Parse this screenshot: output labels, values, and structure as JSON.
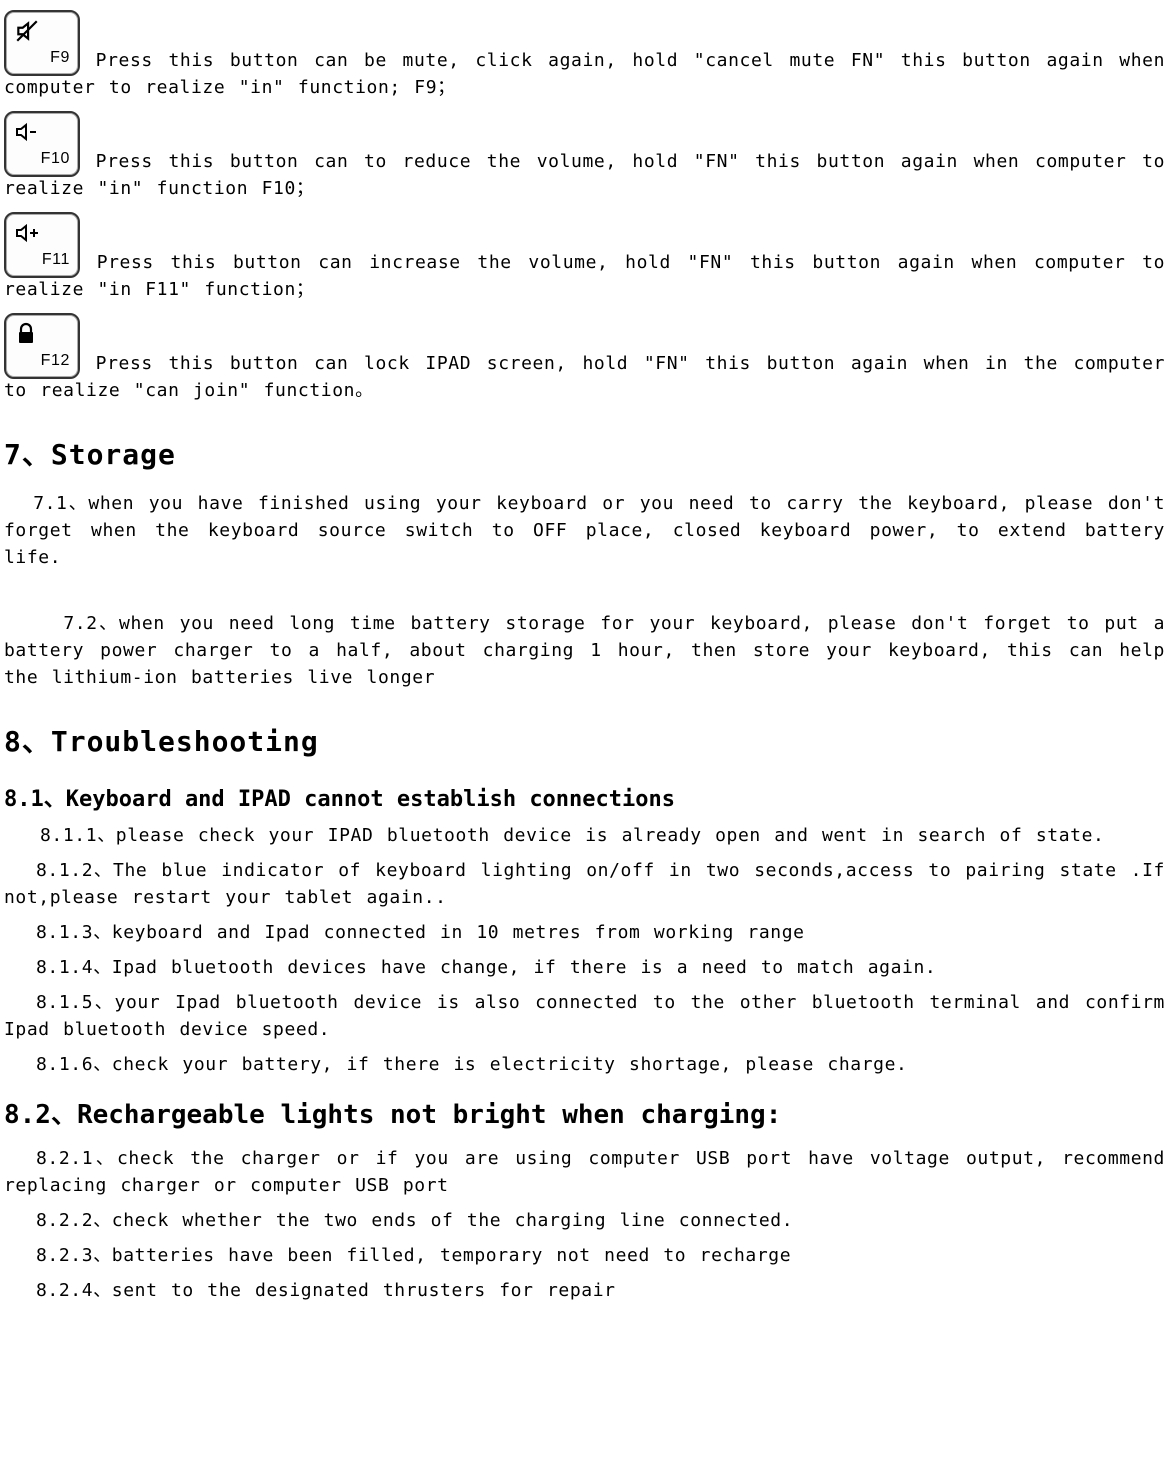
{
  "keys": {
    "f9": {
      "label": "F9",
      "text": " Press this button can be mute, click again, hold \"cancel mute FN\" this button again when computer to realize \"in\" function; F9；"
    },
    "f10": {
      "label": "F10",
      "text": " Press this button can to reduce the volume, hold \"FN\" this button again when computer to realize \"in\" function F10；"
    },
    "f11": {
      "label": "F11",
      "text": " Press this button can increase the volume, hold \"FN\" this button again when computer to realize \"in F11\" function；"
    },
    "f12": {
      "label": "F12",
      "text": " Press this button can lock IPAD screen, hold \"FN\" this button again when in the computer to realize \"can join\" function。"
    }
  },
  "sec7": {
    "heading": "7、Storage",
    "p1": "  7.1、when you have finished using your keyboard or you need to carry the keyboard, please don't forget when the keyboard source switch to OFF place, closed keyboard power, to extend battery life.",
    "p2": "    7.2、when you need long time battery storage for your keyboard, please don't forget to put a battery power charger to a half, about charging 1 hour, then store your keyboard, this can help the lithium-ion batteries live longer"
  },
  "sec8": {
    "heading": "8、Troubleshooting",
    "s81": {
      "heading": "8.1、Keyboard and IPAD cannot establish connections",
      "i1": "8.1.1、please check your IPAD bluetooth device is already open and went in search of state.",
      "i2": "8.1.2、The blue indicator of keyboard lighting on/off in two seconds,access to pairing state .If not,please restart your tablet again..",
      "i3": "8.1.3、keyboard and Ipad connected in 10 metres from working range",
      "i4": "8.1.4、Ipad bluetooth devices have change, if there is a need to match again.",
      "i5": "8.1.5、your Ipad bluetooth device is also connected to the other bluetooth terminal and confirm Ipad bluetooth device speed.",
      "i6": "8.1.6、check your battery, if there is electricity shortage, please charge."
    },
    "s82": {
      "heading": "8.2、Rechargeable lights not bright when charging:",
      "i1": "8.2.1、check the charger or if you are using computer USB port have voltage output, recommend replacing charger or computer USB port",
      "i2": "8.2.2、check whether the two ends of the charging line connected.",
      "i3": "8.2.3、batteries have been filled, temporary not need to recharge",
      "i4": "8.2.4、sent to the designated thrusters for repair"
    }
  }
}
